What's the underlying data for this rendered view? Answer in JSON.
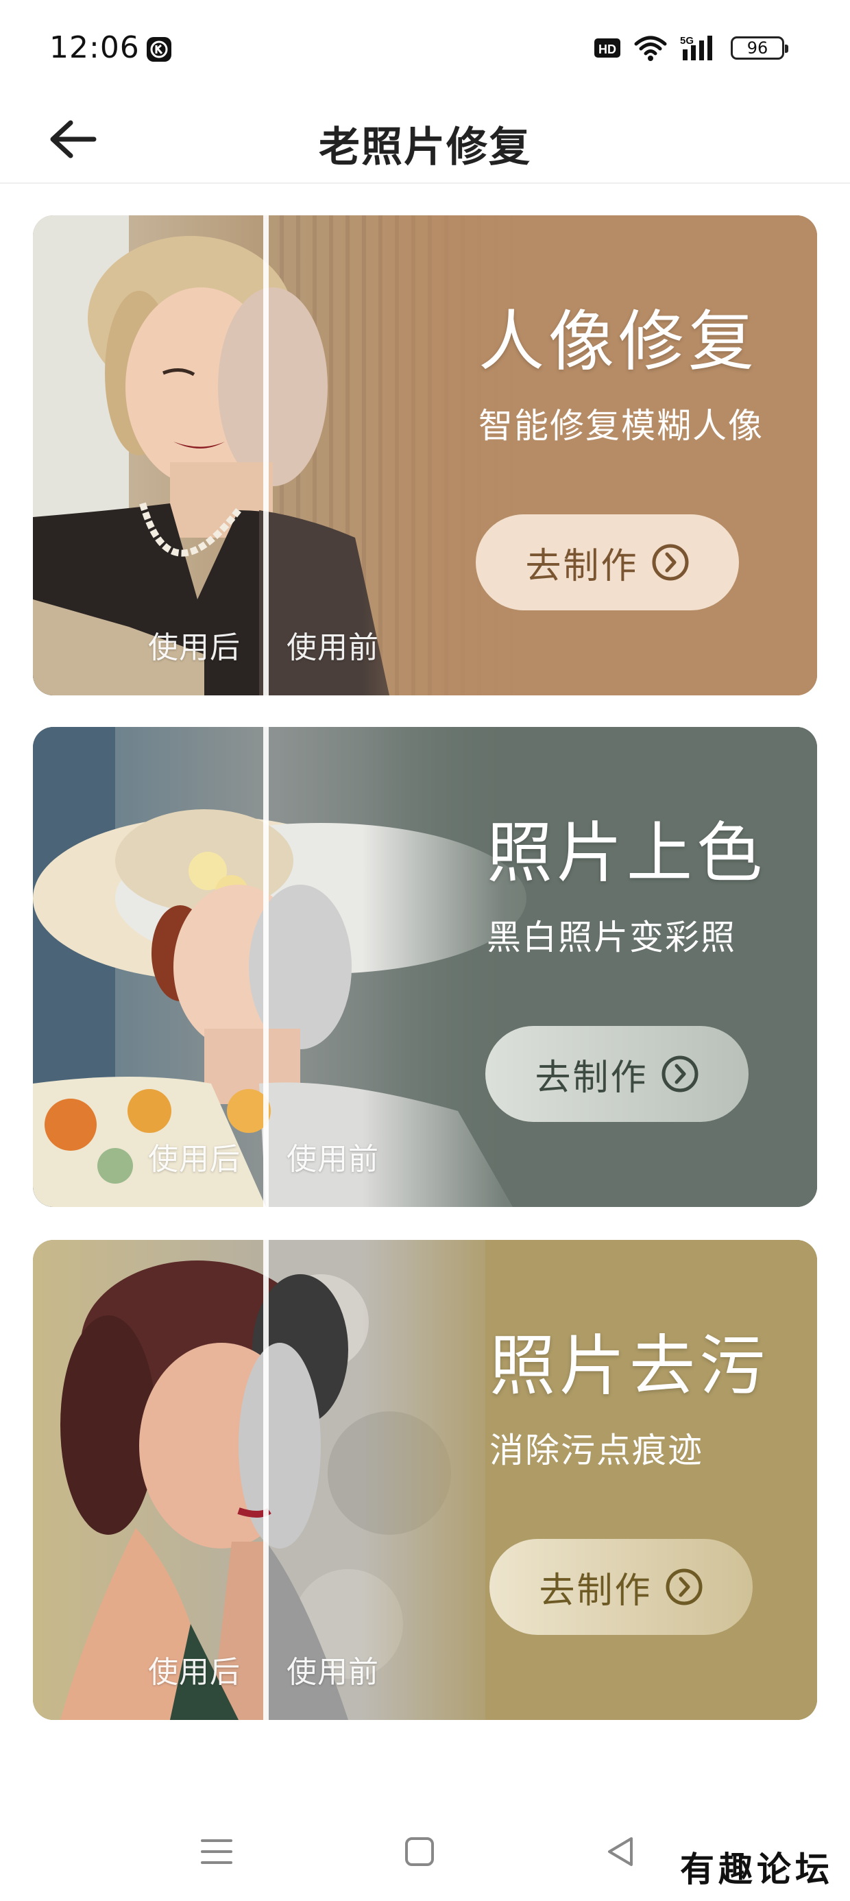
{
  "status_bar": {
    "time": "12:06",
    "network": "5G",
    "hd": "HD",
    "battery": "96"
  },
  "header": {
    "title": "老照片修复",
    "back_icon": "arrow-left-icon"
  },
  "cards": [
    {
      "title": "人像修复",
      "subtitle": "智能修复模糊人像",
      "button_label": "去制作",
      "after_label": "使用后",
      "before_label": "使用前",
      "color": "#b68c66"
    },
    {
      "title": "照片上色",
      "subtitle": "黑白照片变彩照",
      "button_label": "去制作",
      "after_label": "使用后",
      "before_label": "使用前",
      "color": "#65716a"
    },
    {
      "title": "照片去污",
      "subtitle": "消除污点痕迹",
      "button_label": "去制作",
      "after_label": "使用后",
      "before_label": "使用前",
      "color": "#ae9b66"
    }
  ],
  "watermark": "有趣论坛",
  "icons": {
    "menu": "menu-icon",
    "home": "home-icon",
    "back": "back-triangle-icon"
  }
}
